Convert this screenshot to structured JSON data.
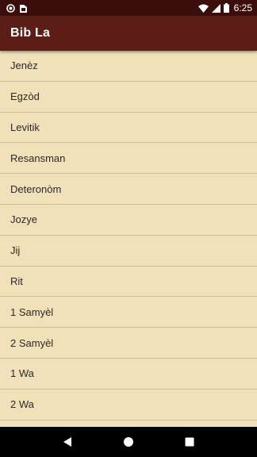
{
  "status_bar": {
    "time": "6:25",
    "icons": [
      "notification-circle-icon",
      "sim-card-icon",
      "wifi-icon",
      "cell-signal-icon",
      "battery-icon"
    ]
  },
  "app_bar": {
    "title": "Bib La"
  },
  "books": [
    {
      "label": "Jenèz"
    },
    {
      "label": "Egzòd"
    },
    {
      "label": "Levitik"
    },
    {
      "label": "Resansman"
    },
    {
      "label": "Deteronòm"
    },
    {
      "label": "Jozye"
    },
    {
      "label": "Jij"
    },
    {
      "label": "Rit"
    },
    {
      "label": "1 Samyèl"
    },
    {
      "label": "2 Samyèl"
    },
    {
      "label": "1 Wa"
    },
    {
      "label": "2 Wa"
    },
    {
      "label": ""
    }
  ],
  "nav_bar": {
    "buttons": [
      "back-icon",
      "home-icon",
      "recents-icon"
    ]
  },
  "colors": {
    "status_bar": "#3c0e0b",
    "app_bar": "#5a1e16",
    "list_background": "#f1e1b9",
    "divider": "#cfbe98"
  }
}
